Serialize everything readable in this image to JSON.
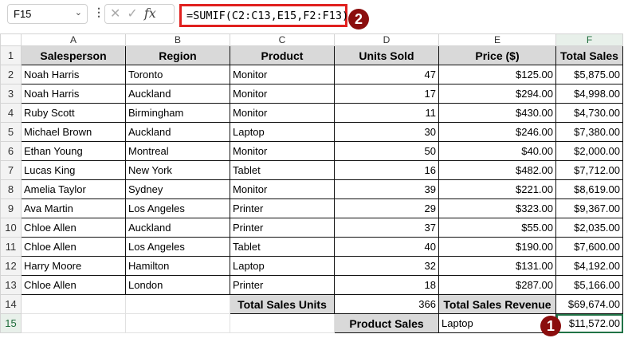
{
  "name_box": "F15",
  "formula": "=SUMIF(C2:C13,E15,F2:F13)",
  "fx_label": "fx",
  "badges": [
    "1",
    "2"
  ],
  "columns": [
    "A",
    "B",
    "C",
    "D",
    "E",
    "F"
  ],
  "headers": [
    "Salesperson",
    "Region",
    "Product",
    "Units Sold",
    "Price ($)",
    "Total Sales"
  ],
  "rows": [
    [
      "Noah Harris",
      "Toronto",
      "Monitor",
      "47",
      "$125.00",
      "$5,875.00"
    ],
    [
      "Noah Harris",
      "Auckland",
      "Monitor",
      "17",
      "$294.00",
      "$4,998.00"
    ],
    [
      "Ruby Scott",
      "Birmingham",
      "Monitor",
      "11",
      "$430.00",
      "$4,730.00"
    ],
    [
      "Michael Brown",
      "Auckland",
      "Laptop",
      "30",
      "$246.00",
      "$7,380.00"
    ],
    [
      "Ethan Young",
      "Montreal",
      "Monitor",
      "50",
      "$40.00",
      "$2,000.00"
    ],
    [
      "Lucas King",
      "New York",
      "Tablet",
      "16",
      "$482.00",
      "$7,712.00"
    ],
    [
      "Amelia Taylor",
      "Sydney",
      "Monitor",
      "39",
      "$221.00",
      "$8,619.00"
    ],
    [
      "Ava Martin",
      "Los Angeles",
      "Printer",
      "29",
      "$323.00",
      "$9,367.00"
    ],
    [
      "Chloe Allen",
      "Auckland",
      "Printer",
      "37",
      "$55.00",
      "$2,035.00"
    ],
    [
      "Chloe Allen",
      "Los Angeles",
      "Tablet",
      "40",
      "$190.00",
      "$7,600.00"
    ],
    [
      "Harry Moore",
      "Hamilton",
      "Laptop",
      "32",
      "$131.00",
      "$4,192.00"
    ],
    [
      "Chloe Allen",
      "London",
      "Printer",
      "18",
      "$287.00",
      "$5,166.00"
    ]
  ],
  "summary": {
    "units_label": "Total Sales Units",
    "units_value": "366",
    "revenue_label": "Total Sales Revenue",
    "revenue_value": "$69,674.00",
    "product_label": "Product Sales",
    "product_value": "Laptop",
    "product_result": "$11,572.00"
  }
}
